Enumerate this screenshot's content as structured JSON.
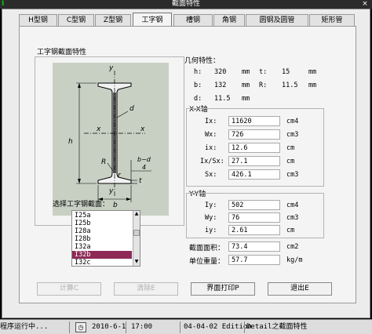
{
  "window": {
    "title": "截面特性",
    "app_icon": "I"
  },
  "tabs": [
    {
      "label": "H型钢"
    },
    {
      "label": "C型钢"
    },
    {
      "label": "Z型钢"
    },
    {
      "label": "工字钢"
    },
    {
      "label": "槽钢"
    },
    {
      "label": "角钢"
    },
    {
      "label": "圆钢及圆管"
    },
    {
      "label": "矩形管"
    }
  ],
  "diagram": {
    "title": "工字钢截面特性",
    "labels": {
      "y_top": "y",
      "y_bottom": "y",
      "x_left": "x",
      "x_right": "x",
      "h": "h",
      "d": "d",
      "R": "R",
      "r": "r",
      "t": "t",
      "b": "b",
      "bd_num": "b−d",
      "bd_den": "4"
    },
    "watermark": "工 方 正"
  },
  "select": {
    "label": "选择工字钢截面：",
    "items": [
      "I25a",
      "I25b",
      "I28a",
      "I28b",
      "I32a",
      "I32b",
      "I32c"
    ],
    "selected": "I32b"
  },
  "geometry": {
    "title": "几何特性：",
    "h": {
      "label": "h:",
      "value": "320",
      "unit": "mm"
    },
    "t": {
      "label": "t:",
      "value": "15",
      "unit": "mm"
    },
    "b": {
      "label": "b:",
      "value": "132",
      "unit": "mm"
    },
    "R": {
      "label": "R:",
      "value": "11.5",
      "unit": "mm"
    },
    "d": {
      "label": "d:",
      "value": "11.5",
      "unit": "mm"
    }
  },
  "xx_axis": {
    "title": "X-X轴",
    "Ix": {
      "label": "Ix:",
      "value": "11620",
      "unit": "cm4"
    },
    "Wx": {
      "label": "Wx:",
      "value": "726",
      "unit": "cm3"
    },
    "ix": {
      "label": "ix:",
      "value": "12.6",
      "unit": "cm"
    },
    "IxSx": {
      "label": "Ix/Sx:",
      "value": "27.1",
      "unit": "cm"
    },
    "Sx": {
      "label": "Sx:",
      "value": "426.1",
      "unit": "cm3"
    }
  },
  "yy_axis": {
    "title": "Y-Y轴",
    "Iy": {
      "label": "Iy:",
      "value": "502",
      "unit": "cm4"
    },
    "Wy": {
      "label": "Wy:",
      "value": "76",
      "unit": "cm3"
    },
    "iy": {
      "label": "iy:",
      "value": "2.61",
      "unit": "cm"
    }
  },
  "section": {
    "area": {
      "label": "截面面积：",
      "value": "73.4",
      "unit": "cm2"
    },
    "weight": {
      "label": "单位重量：",
      "value": "57.7",
      "unit": "kg/m"
    }
  },
  "buttons": {
    "calc": "计算C",
    "clear": "清除E",
    "print": "界面打印P",
    "exit": "退出E"
  },
  "statusbar": {
    "left": "程序运行中...",
    "date": "2010-6-1",
    "time": "17:00",
    "edition": "04-04-02 Edition",
    "module": "Detail之截面特性"
  }
}
